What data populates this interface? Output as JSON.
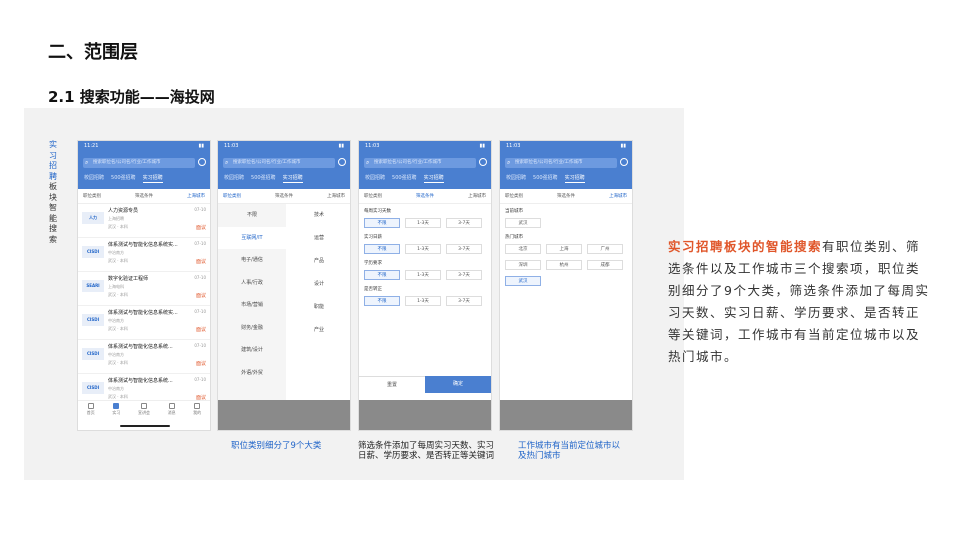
{
  "slide": {
    "title": "二、范围层",
    "subtitle": "2.1 搜索功能——海投网",
    "vertical_label_a": "实习招聘",
    "vertical_label_b": "板块智能搜索"
  },
  "phones": [
    {
      "status_time": "11:21",
      "search_placeholder": "搜索职位名/公司名/行业/工作城市",
      "tabs": [
        "校园招聘",
        "500强招聘",
        "实习招聘"
      ],
      "filters": [
        "职位类别",
        "筛选条件",
        "上海城市"
      ],
      "jobs": [
        {
          "title": "人力资源专员",
          "company": "上海招聘",
          "meta": "武汉 · 本科",
          "date": "07-10",
          "salary": "面议"
        },
        {
          "title": "体系测试与智能化信息系统实...",
          "company": "中冶南方",
          "meta": "武汉 · 本科",
          "date": "07-10",
          "salary": "面议"
        },
        {
          "title": "数字化验证工程师",
          "company": "上海电科",
          "meta": "武汉 · 本科",
          "date": "07-10",
          "salary": "面议"
        },
        {
          "title": "体系测试与智能化信息系统实...",
          "company": "中冶南方",
          "meta": "武汉 · 本科",
          "date": "07-10",
          "salary": "面议"
        },
        {
          "title": "体系测试与智能化信息系统...",
          "company": "中冶南方",
          "meta": "武汉 · 本科",
          "date": "07-10",
          "salary": "面议"
        },
        {
          "title": "体系测试与智能化信息系统...",
          "company": "中冶南方",
          "meta": "武汉 · 本科",
          "date": "07-10",
          "salary": "面议"
        }
      ],
      "nav": [
        "首页",
        "实习",
        "宣讲会",
        "消息",
        "我的"
      ]
    },
    {
      "status_time": "11:03",
      "search_placeholder": "搜索职位名/公司名/行业/工作城市",
      "tabs": [
        "校园招聘",
        "500强招聘",
        "实习招聘"
      ],
      "filters": [
        "职位类别",
        "筛选条件",
        "上海城市"
      ],
      "categories": [
        "不限",
        "互联网/IT",
        "电子/通信",
        "人事/行政",
        "市场/营销",
        "财务/金融",
        "建筑/设计",
        "外语/外贸"
      ],
      "subcategories": [
        "技术",
        "运营",
        "产品",
        "设计",
        "职能",
        "产业"
      ]
    },
    {
      "status_time": "11:03",
      "search_placeholder": "搜索职位名/公司名/行业/工作城市",
      "tabs": [
        "校园招聘",
        "500强招聘",
        "实习招聘"
      ],
      "filters": [
        "职位类别",
        "筛选条件",
        "上海城市"
      ],
      "sections": [
        {
          "label": "每周实习天数",
          "options": [
            "不限",
            "1-3天",
            "3-7天"
          ]
        },
        {
          "label": "实习日薪",
          "options": [
            "不限",
            "1-3天",
            "3-7天"
          ]
        },
        {
          "label": "学历要求",
          "options": [
            "不限",
            "1-3天",
            "3-7天"
          ]
        },
        {
          "label": "是否转正",
          "options": [
            "不限",
            "1-3天",
            "3-7天"
          ]
        }
      ],
      "reset_label": "重置",
      "confirm_label": "确定"
    },
    {
      "status_time": "11:03",
      "search_placeholder": "搜索职位名/公司名/行业/工作城市",
      "tabs": [
        "校园招聘",
        "500强招聘",
        "实习招聘"
      ],
      "filters": [
        "职位类别",
        "筛选条件",
        "上海城市"
      ],
      "current_city_label": "当前城市",
      "current_city": "武汉",
      "hot_city_label": "热门城市",
      "hot_cities": [
        "北京",
        "上海",
        "广州",
        "深圳",
        "杭州",
        "成都",
        "武汉"
      ]
    }
  ],
  "captions": {
    "c1": "职位类别细分了9个大类",
    "c2": "筛选条件添加了每周实习天数、实习日薪、学历要求、是否转正等关键词",
    "c3": "工作城市有当前定位城市以及热门城市"
  },
  "description": {
    "highlight": "实习招聘板块的智能搜索",
    "body": "有职位类别、筛选条件以及工作城市三个搜索项，职位类别细分了9个大类，筛选条件添加了每周实习天数、实习日薪、学历要求、是否转正等关键词，工作城市有当前定位城市以及热门城市。"
  },
  "colors": {
    "accent_blue": "#4a7fd0",
    "highlight_orange": "#e0562a"
  }
}
